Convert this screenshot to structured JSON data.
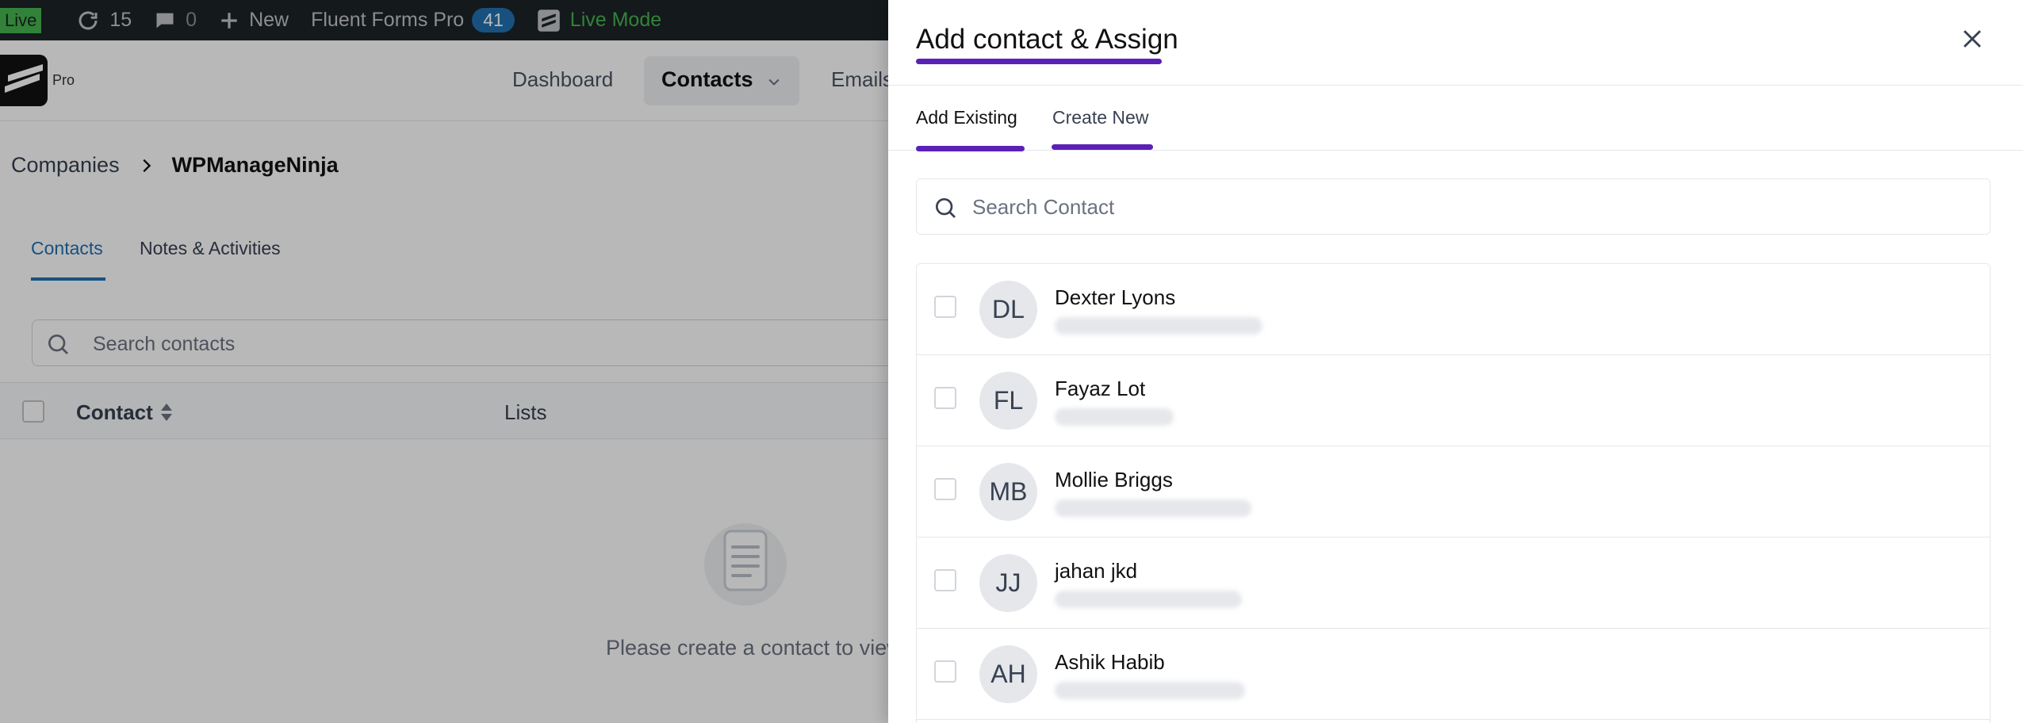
{
  "adminbar": {
    "live_label": "Live",
    "updates_count": "15",
    "comments_count": "0",
    "new_label": "New",
    "forms_label": "Fluent Forms Pro",
    "forms_badge": "41",
    "mode_label": "Live Mode"
  },
  "topnav": {
    "logo_suffix": "Pro",
    "dashboard": "Dashboard",
    "contacts": "Contacts",
    "emails": "Emails"
  },
  "breadcrumb": {
    "parent": "Companies",
    "current": "WPManageNinja"
  },
  "company_tabs": [
    "Contacts",
    "Notes & Activities"
  ],
  "company_search": {
    "placeholder": "Search contacts"
  },
  "company_table": {
    "columns": [
      "Contact",
      "Lists"
    ],
    "empty_text": "Please create a contact to view"
  },
  "drawer": {
    "title": "Add contact & Assign",
    "tabs": {
      "existing": "Add Existing",
      "create": "Create New"
    },
    "search_placeholder": "Search Contact",
    "contacts": [
      {
        "initials": "DL",
        "name": "Dexter Lyons"
      },
      {
        "initials": "FL",
        "name": "Fayaz Lot"
      },
      {
        "initials": "MB",
        "name": "Mollie Briggs"
      },
      {
        "initials": "JJ",
        "name": "jahan jkd"
      },
      {
        "initials": "AH",
        "name": "Ashik Habib"
      }
    ]
  },
  "colors": {
    "accent_underline": "#5b21b6",
    "link_blue": "#2271b1",
    "live_green": "#46b450"
  }
}
